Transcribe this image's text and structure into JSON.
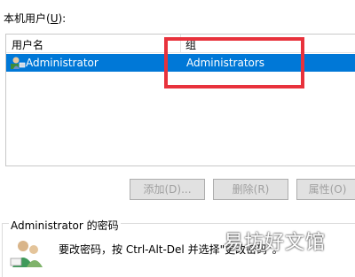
{
  "users_label": "本机用户(",
  "users_label_key": "U",
  "users_label_end": "):",
  "list": {
    "col_username": "用户名",
    "col_group": "组",
    "rows": [
      {
        "username": "Administrator",
        "group": "Administrators"
      }
    ]
  },
  "buttons": {
    "add": "添加(D)...",
    "delete": "删除(R)",
    "properties": "属性(O)"
  },
  "password_section": {
    "title": "Administrator 的密码",
    "instruction": "要改密码，按 Ctrl-Alt-Del 并选择\"更改密码\"。"
  },
  "watermark": "易坊好文馆",
  "colors": {
    "selection": "#0078d7",
    "highlight_box": "#e8323c"
  },
  "icons": {
    "user": "user-icon",
    "password": "users-key-icon"
  }
}
